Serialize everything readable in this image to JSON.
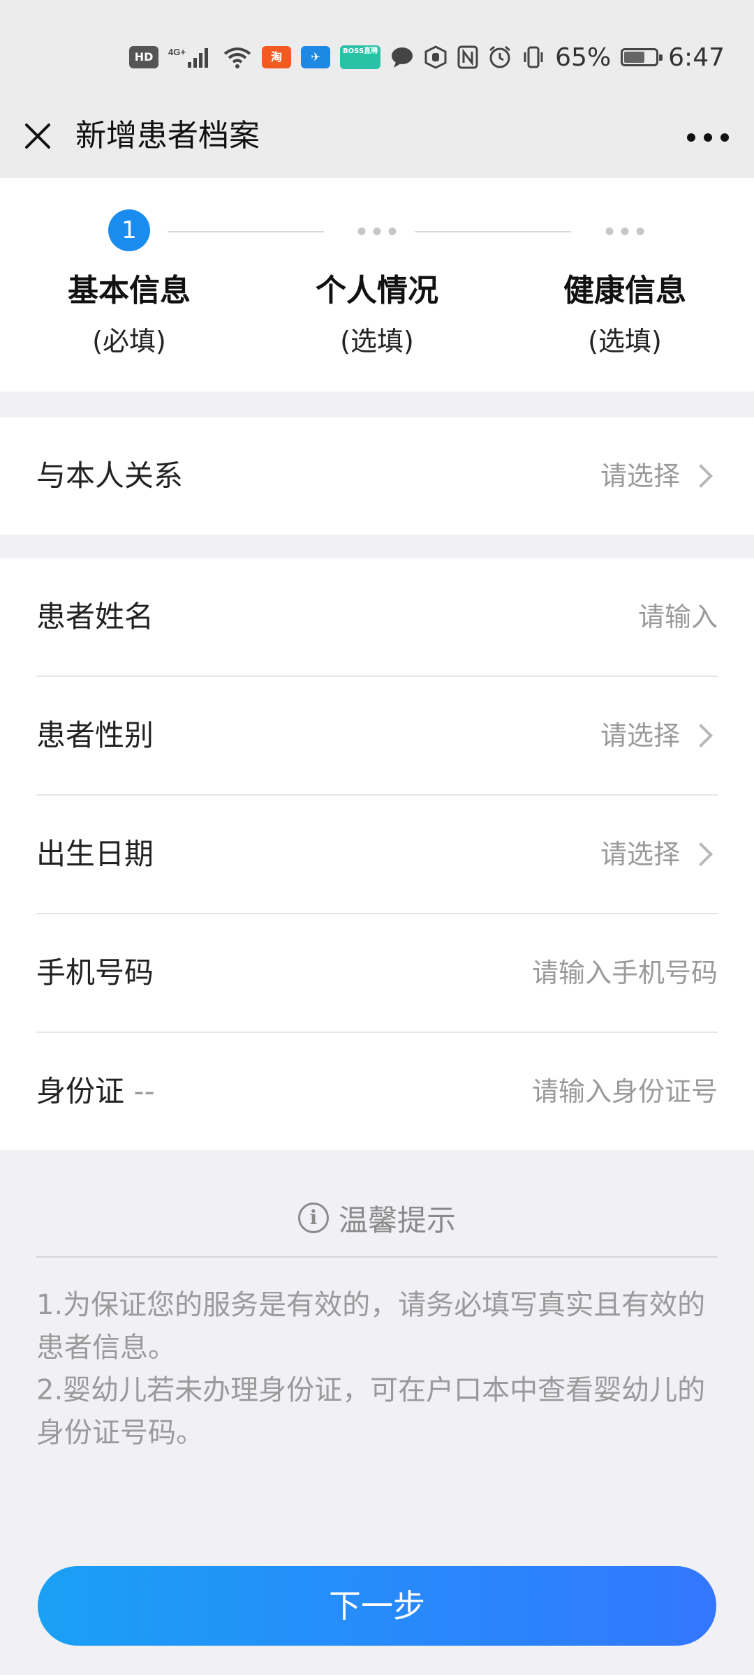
{
  "status_bar": {
    "icons": [
      "hd-icon",
      "4g-signal-icon",
      "wifi-icon",
      "app-notification-icon",
      "dingtalk-icon",
      "boss-zhipin-icon",
      "message-icon",
      "hand-icon",
      "nfc-icon",
      "alarm-icon",
      "vibrate-icon"
    ],
    "boss_label": "BOSS直聘",
    "battery_percent": "65%",
    "battery_level": 0.65,
    "time": "6:47"
  },
  "nav": {
    "title": "新增患者档案"
  },
  "steps": [
    {
      "number": "1",
      "title": "基本信息",
      "subtitle": "(必填)",
      "active": true
    },
    {
      "number": "",
      "title": "个人情况",
      "subtitle": "(选填)",
      "active": false
    },
    {
      "number": "",
      "title": "健康信息",
      "subtitle": "(选填)",
      "active": false
    }
  ],
  "form": {
    "relation": {
      "label": "与本人关系",
      "placeholder": "请选择"
    },
    "name": {
      "label": "患者姓名",
      "placeholder": "请输入"
    },
    "gender": {
      "label": "患者性别",
      "placeholder": "请选择"
    },
    "birthdate": {
      "label": "出生日期",
      "placeholder": "请选择"
    },
    "phone": {
      "label": "手机号码",
      "placeholder": "请输入手机号码"
    },
    "id_card": {
      "label": "身份证",
      "suffix": "--",
      "placeholder": "请输入身份证号"
    }
  },
  "tips": {
    "title": "温馨提示",
    "items": [
      "1.为保证您的服务是有效的，请务必填写真实且有效的患者信息。",
      "2.婴幼儿若未办理身份证，可在户口本中查看婴幼儿的身份证号码。"
    ]
  },
  "next_button": {
    "label": "下一步"
  },
  "colors": {
    "accent": "#1a8cf0",
    "button_start": "#1aa0f5",
    "button_end": "#3377ff"
  }
}
